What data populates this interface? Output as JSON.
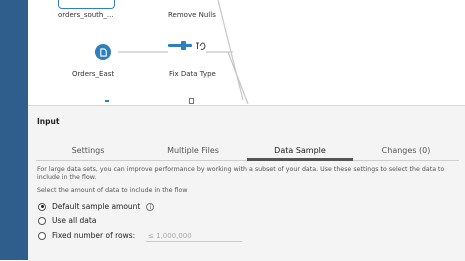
{
  "flow": {
    "nodes": {
      "orders_south": "orders_south_...",
      "remove_nulls": "Remove Nulls",
      "orders_east": "Orders_East",
      "fix_data_type": "Fix Data Type"
    }
  },
  "panel": {
    "title": "Input",
    "tabs": [
      "Settings",
      "Multiple Files",
      "Data Sample",
      "Changes (0)"
    ],
    "active_tab": "Data Sample",
    "description": "For large data sets, you can improve performance by working with a subset of your data. Use these settings to select the data to include in the flow.",
    "select_label": "Select the amount of data to include in the flow",
    "options": [
      {
        "label": "Default sample amount",
        "selected": true
      },
      {
        "label": "Use all data",
        "selected": false
      },
      {
        "label": "Fixed number of rows:",
        "selected": false
      }
    ],
    "rows_placeholder": "≤ 1,000,000"
  },
  "colors": {
    "sidebar": "#2f5d8c",
    "accent": "#2f7fbf"
  }
}
